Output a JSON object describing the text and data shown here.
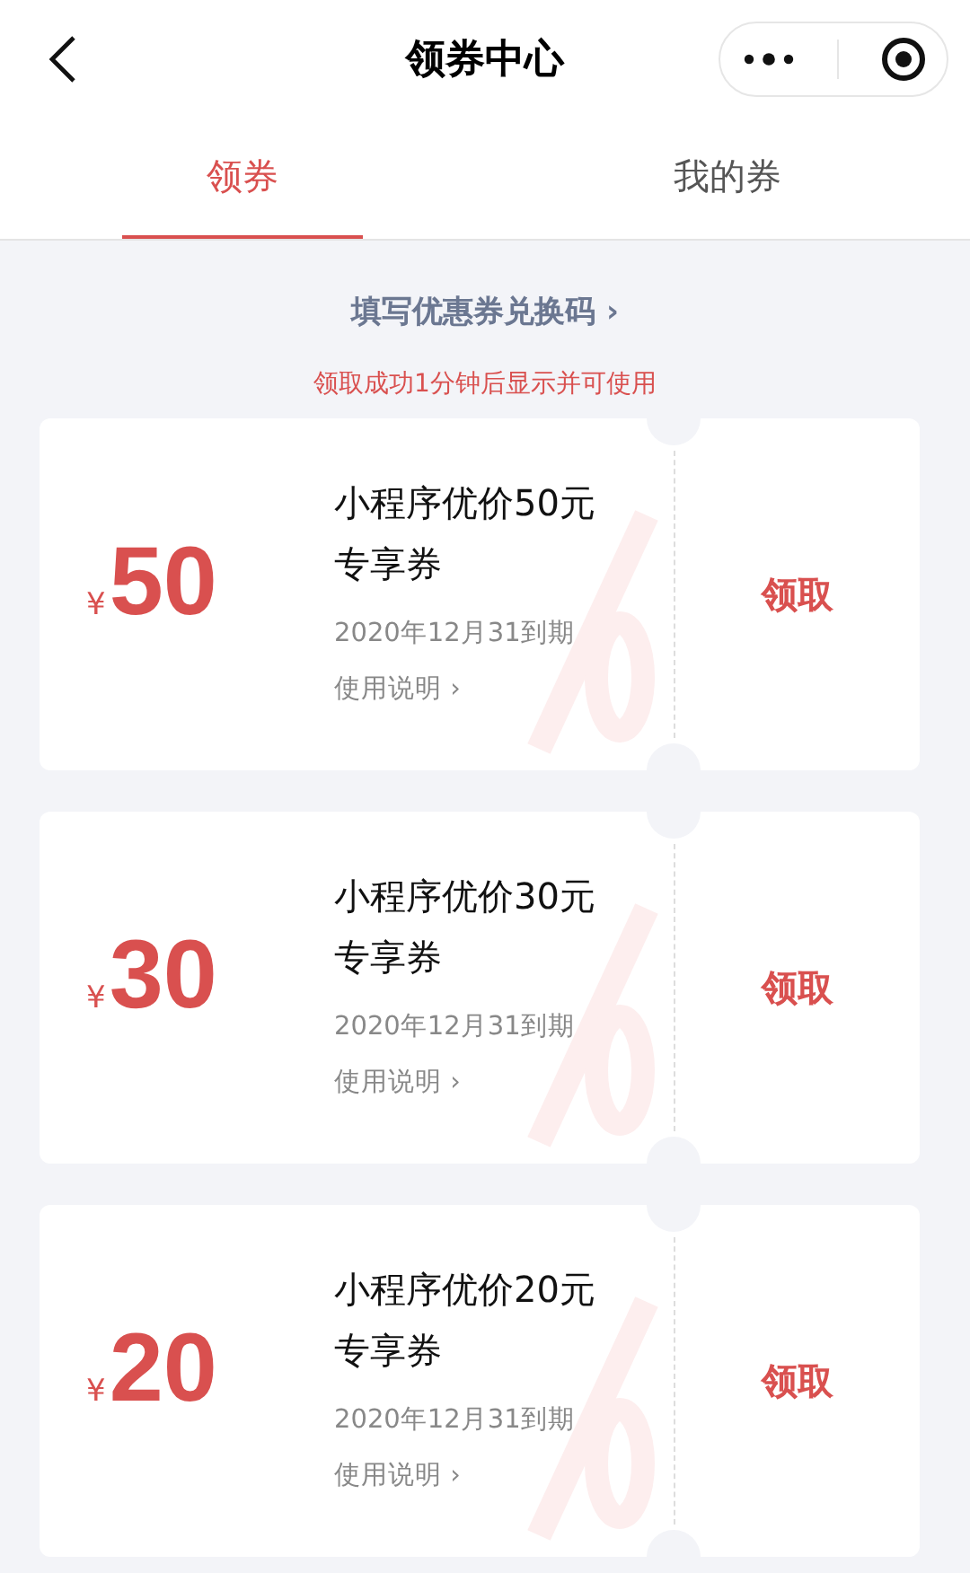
{
  "window": {
    "title": "领券中心"
  },
  "tabs": [
    {
      "label": "领券",
      "selected": true
    },
    {
      "label": "我的券",
      "selected": false
    }
  ],
  "redeem_link": "填写优惠券兑换码 ›",
  "notice": "领取成功1分钟后显示并可使用",
  "coupons": [
    {
      "currency": "¥",
      "amount": "50",
      "title": "小程序优价50元专享券",
      "expiry": "2020年12月31到期",
      "instructions": "使用说明 ›",
      "action": "领取"
    },
    {
      "currency": "¥",
      "amount": "30",
      "title": "小程序优价30元专享券",
      "expiry": "2020年12月31到期",
      "instructions": "使用说明 ›",
      "action": "领取"
    },
    {
      "currency": "¥",
      "amount": "20",
      "title": "小程序优价20元专享券",
      "expiry": "2020年12月31到期",
      "instructions": "使用说明 ›",
      "action": "领取"
    }
  ]
}
